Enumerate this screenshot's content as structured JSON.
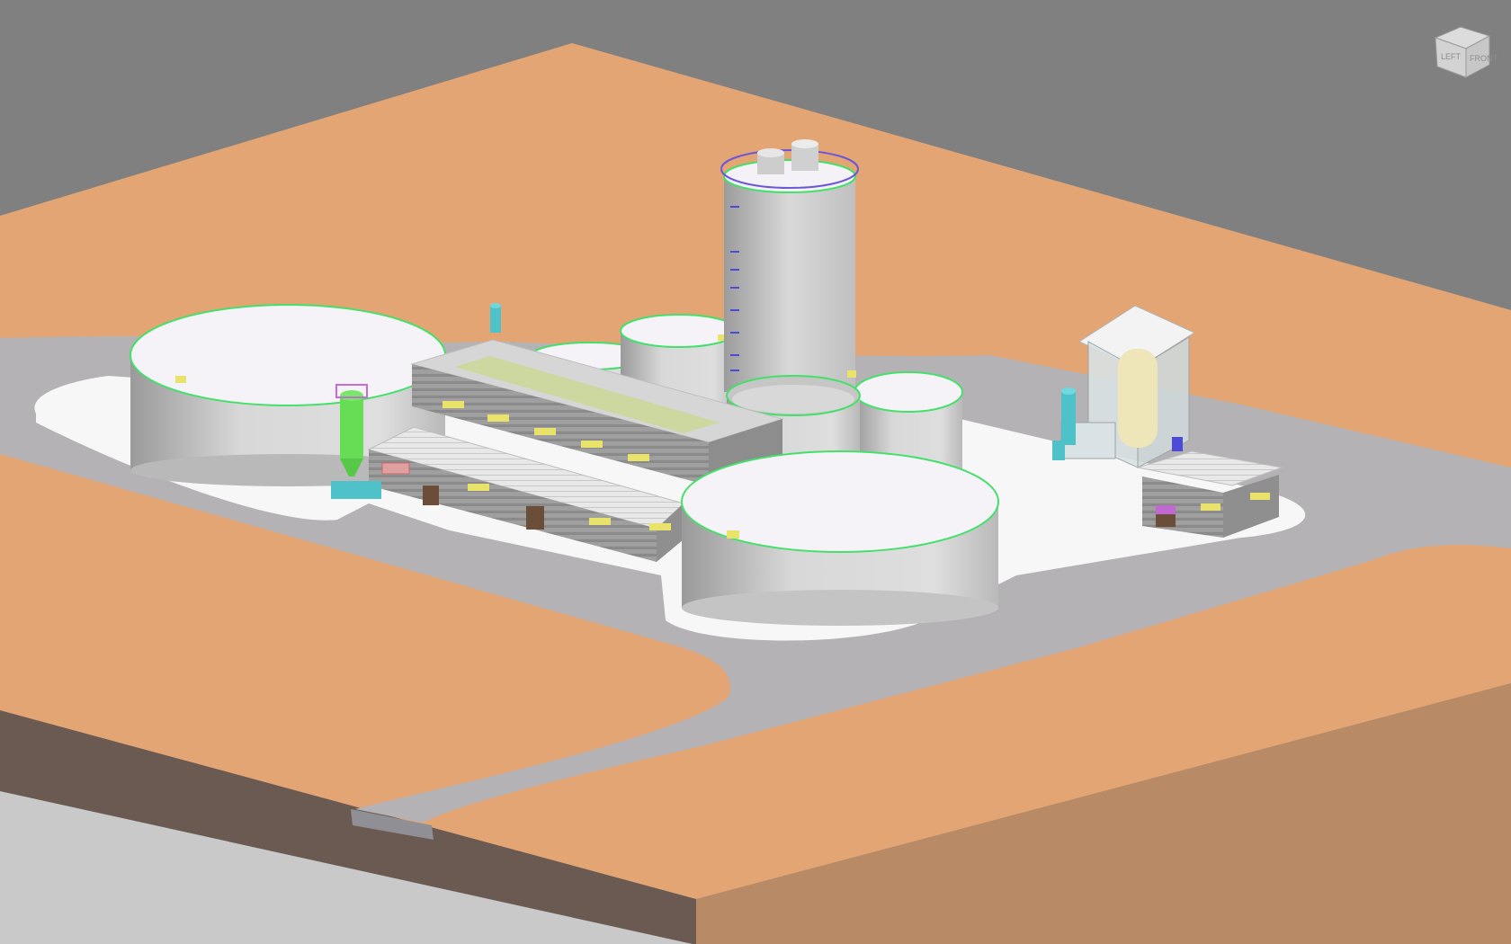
{
  "viewport": {
    "background": "#808080",
    "ground_color": "#e3a574",
    "ground_side_left": "#6b5a52",
    "ground_side_right": "#b98a66",
    "road_color": "#b5b2b5",
    "pad_color": "#f7f7f7",
    "tank_wall": "#d3d3d3",
    "tank_roof": "#f6f3f8",
    "tank_rim": "#44e06a",
    "building_wall": "#a9a9a9",
    "building_roof": "#e4e4e4"
  },
  "viewcube": {
    "left_label": "LEFT",
    "front_label": "FRONT",
    "icon": "view-cube-icon"
  },
  "scene_objects": [
    {
      "name": "large-storage-tank-west",
      "kind": "tank"
    },
    {
      "name": "large-storage-tank-south",
      "kind": "tank"
    },
    {
      "name": "tall-silo-tower",
      "kind": "tower"
    },
    {
      "name": "medium-tank-north",
      "kind": "tank"
    },
    {
      "name": "medium-tank-center",
      "kind": "tank"
    },
    {
      "name": "medium-tank-east",
      "kind": "tank"
    },
    {
      "name": "small-tank-behind-building",
      "kind": "tank"
    },
    {
      "name": "main-process-building",
      "kind": "building"
    },
    {
      "name": "lower-annex-building",
      "kind": "building"
    },
    {
      "name": "green-dosing-silo",
      "kind": "equipment"
    },
    {
      "name": "glazed-process-house",
      "kind": "building"
    },
    {
      "name": "small-shed",
      "kind": "building"
    },
    {
      "name": "access-road",
      "kind": "road"
    }
  ]
}
